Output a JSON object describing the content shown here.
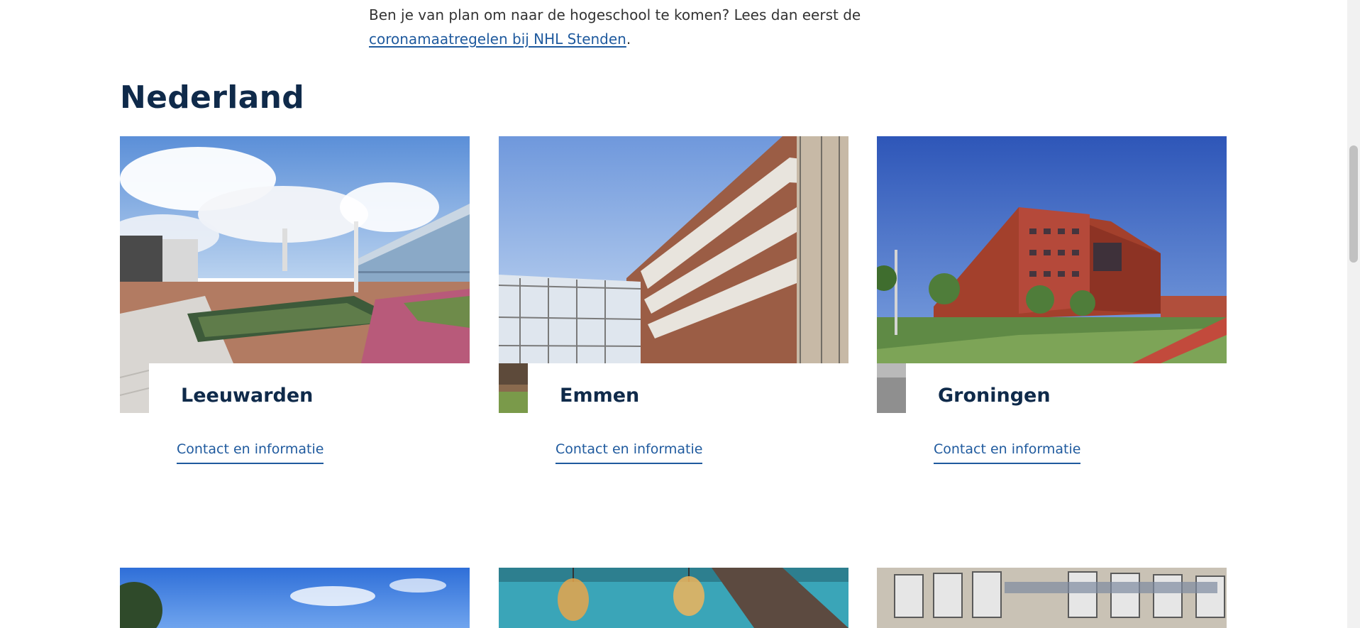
{
  "intro": {
    "line1": "Ben je van plan om naar de hogeschool te komen? Lees dan eerst de",
    "link_text": "coronamaatregelen bij NHL Stenden",
    "after_link": "."
  },
  "section": {
    "heading": "Nederland"
  },
  "cards": [
    {
      "city": "Leeuwarden",
      "link": "Contact en informatie"
    },
    {
      "city": "Emmen",
      "link": "Contact en informatie"
    },
    {
      "city": "Groningen",
      "link": "Contact en informatie"
    }
  ],
  "colors": {
    "heading": "#0f2a4a",
    "link": "#1f5a9e"
  }
}
